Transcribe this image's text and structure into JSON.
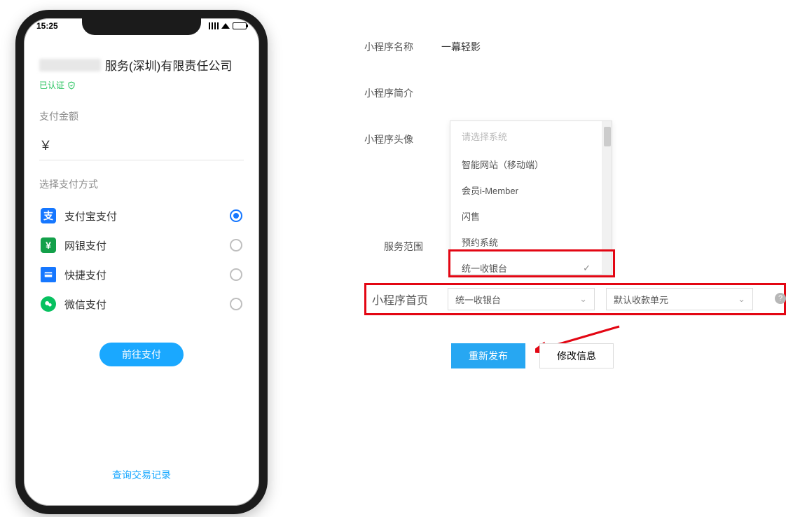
{
  "phone": {
    "time": "15:25",
    "company_suffix": "服务(深圳)有限责任公司",
    "verified": "已认证",
    "amount_label": "支付金额",
    "currency": "￥",
    "method_label": "选择支付方式",
    "methods": {
      "alipay": "支付宝支付",
      "unionpay": "网银支付",
      "quickpay": "快捷支付",
      "wechat": "微信支付"
    },
    "pay_btn": "前往支付",
    "query_link": "查询交易记录"
  },
  "form": {
    "name_label": "小程序名称",
    "name_value": "一幕轻影",
    "intro_label": "小程序简介",
    "avatar_label": "小程序头像",
    "scope_label": "服务范围",
    "homepage_label": "小程序首页",
    "dropdown": {
      "placeholder": "请选择系统",
      "opt_smartweb": "智能网站（移动端）",
      "opt_member": "会员i-Member",
      "opt_flash": "闪售",
      "opt_booking": "预约系统",
      "opt_cashier": "统一收银台"
    },
    "homepage_select1": "统一收银台",
    "homepage_select2": "默认收款单元",
    "republish_btn": "重新发布",
    "modify_btn": "修改信息"
  }
}
